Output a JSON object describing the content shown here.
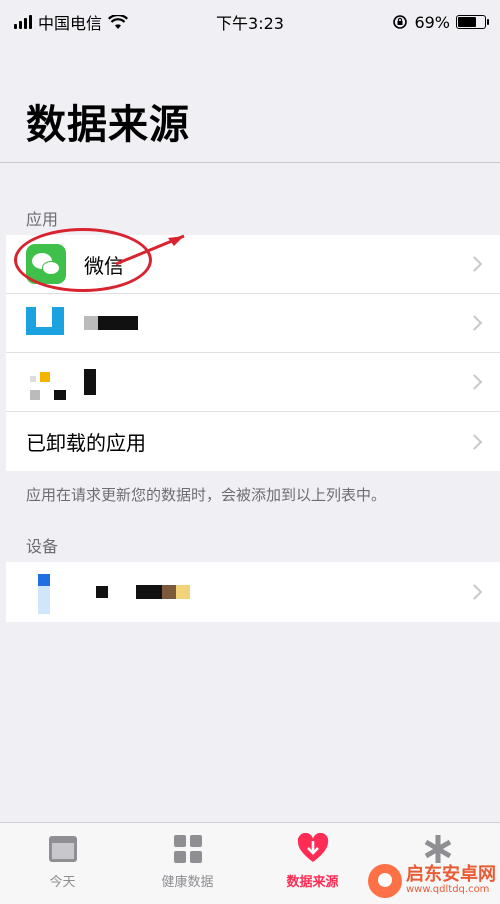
{
  "status_bar": {
    "carrier": "中国电信",
    "time": "下午3:23",
    "battery": "69%",
    "battery_level": 0.69
  },
  "title": "数据来源",
  "apps_section": {
    "header": "应用",
    "items": [
      {
        "label": "微信",
        "icon": "wechat-icon"
      },
      {
        "label": "",
        "icon": "app-icon-u",
        "redacted": true
      },
      {
        "label": "",
        "icon": "app-icon-pixel",
        "redacted": true
      }
    ],
    "uninstalled_label": "已卸载的应用",
    "footer": "应用在请求更新您的数据时，会被添加到以上列表中。"
  },
  "devices_section": {
    "header": "设备",
    "items": [
      {
        "label": "",
        "icon": "device-icon",
        "redacted": true
      }
    ]
  },
  "tabs": [
    {
      "label": "今天",
      "icon": "calendar-icon",
      "active": false
    },
    {
      "label": "健康数据",
      "icon": "grid-icon",
      "active": false
    },
    {
      "label": "数据来源",
      "icon": "heart-download-icon",
      "active": true
    },
    {
      "label": "",
      "icon": "asterisk-icon",
      "active": false
    }
  ],
  "colors": {
    "accent": "#ff2d55",
    "annotation": "#d9232f",
    "wechat": "#3ec04a"
  },
  "watermark": {
    "text_cn": "启东安卓网",
    "text_url": "www.qdltdq.com"
  }
}
